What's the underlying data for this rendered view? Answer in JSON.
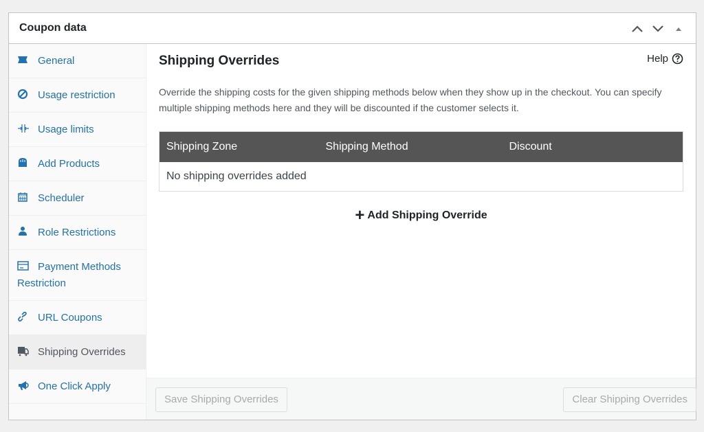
{
  "panel": {
    "title": "Coupon data",
    "actions": [
      {
        "name": "move-up",
        "icon": "chevron-up-icon"
      },
      {
        "name": "move-down",
        "icon": "chevron-down-icon"
      },
      {
        "name": "toggle-panel",
        "icon": "triangle-up-icon"
      }
    ]
  },
  "sidebar": {
    "items": [
      {
        "label": "General",
        "icon": "ticket-icon",
        "active": false
      },
      {
        "label": "Usage restriction",
        "icon": "block-icon",
        "active": false
      },
      {
        "label": "Usage limits",
        "icon": "limits-icon",
        "active": false
      },
      {
        "label": "Add Products",
        "icon": "basket-icon",
        "active": false
      },
      {
        "label": "Scheduler",
        "icon": "calendar-icon",
        "active": false
      },
      {
        "label": "Role Restrictions",
        "icon": "user-icon",
        "active": false
      },
      {
        "label": "Payment Methods Restriction",
        "icon": "card-icon",
        "active": false
      },
      {
        "label": "URL Coupons",
        "icon": "link-icon",
        "active": false
      },
      {
        "label": "Shipping Overrides",
        "icon": "truck-icon",
        "active": true
      },
      {
        "label": "One Click Apply",
        "icon": "megaphone-icon",
        "active": false
      }
    ]
  },
  "main": {
    "title": "Shipping Overrides",
    "help_label": "Help",
    "description": "Override the shipping costs for the given shipping methods below when they show up in the checkout. You can specify multiple shipping methods here and they will be discounted if the customer selects it.",
    "table": {
      "columns": [
        "Shipping Zone",
        "Shipping Method",
        "Discount"
      ],
      "empty_message": "No shipping overrides added"
    },
    "add_label": "Add Shipping Override",
    "save_label": "Save Shipping Overrides",
    "clear_label": "Clear Shipping Overrides"
  },
  "colors": {
    "link": "#2271b1",
    "table_header": "#555555"
  }
}
